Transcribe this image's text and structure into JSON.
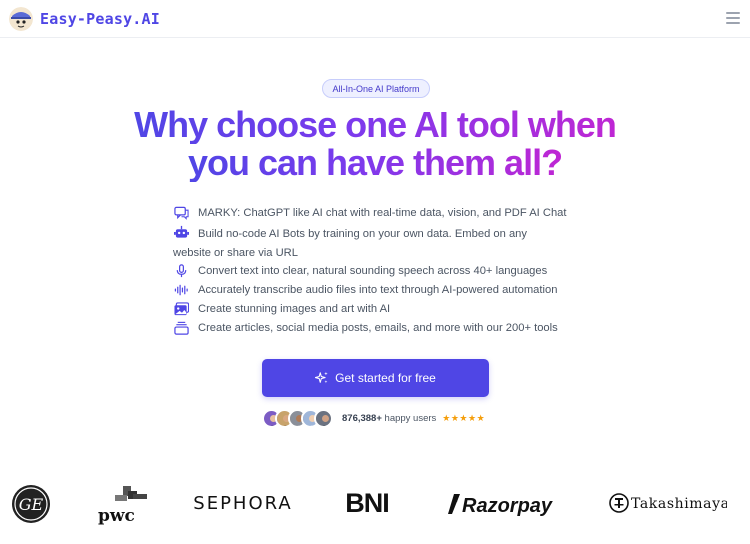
{
  "brand": {
    "name": "Easy-Peasy.AI",
    "logo_icon": "mascot-logo"
  },
  "header": {
    "menu_icon": "hamburger-icon"
  },
  "hero": {
    "badge": "All-In-One AI Platform",
    "headline_line1": "Why choose one AI tool when",
    "headline_line2": "you can have them all?",
    "gradient_colors": [
      "#4f46e5",
      "#7c3aed",
      "#c026d3"
    ]
  },
  "features": [
    {
      "icon": "chat-icon",
      "text": "MARKY: ChatGPT like AI chat with real-time data, vision, and PDF AI Chat"
    },
    {
      "icon": "robot-icon",
      "text": "Build no-code AI Bots by training on your own data. Embed on any website or share via URL"
    },
    {
      "icon": "microphone-icon",
      "text": "Convert text into clear, natural sounding speech across 40+ languages"
    },
    {
      "icon": "audio-wave-icon",
      "text": "Accurately transcribe audio files into text through AI-powered automation"
    },
    {
      "icon": "image-icon",
      "text": "Create stunning images and art with AI"
    },
    {
      "icon": "layers-icon",
      "text": "Create articles, social media posts, emails, and more with our 200+ tools"
    }
  ],
  "cta": {
    "label": "Get started for free",
    "icon": "sparkles-icon",
    "color": "#4f46e5"
  },
  "social_proof": {
    "count": "876,388+",
    "suffix": " happy users",
    "stars": "★★★★★",
    "rating": 5
  },
  "logos": {
    "ge": "GE",
    "pwc": "pwc",
    "sephora": "SEPHORA",
    "bni": "BNI",
    "razorpay": "Razorpay",
    "takashimaya": "Takashimaya"
  }
}
